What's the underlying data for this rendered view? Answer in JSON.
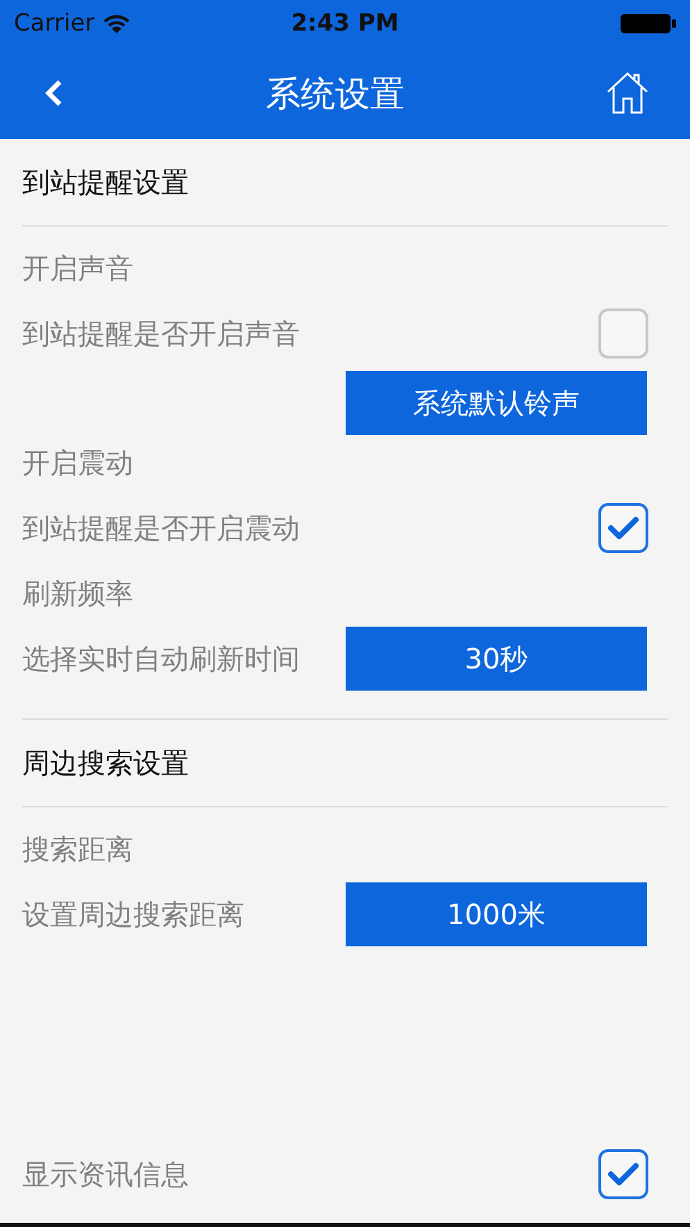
{
  "status_bar": {
    "carrier": "Carrier",
    "time": "2:43 PM"
  },
  "nav_bar": {
    "title": "系统设置"
  },
  "sections": [
    {
      "title": "到站提醒设置",
      "rows": [
        {
          "kind": "heading",
          "text": "开启声音"
        },
        {
          "kind": "checkbox",
          "label": "到站提醒是否开启声音",
          "checked": false
        },
        {
          "kind": "button",
          "text": "系统默认铃声"
        },
        {
          "kind": "heading",
          "text": "开启震动"
        },
        {
          "kind": "checkbox",
          "label": "到站提醒是否开启震动",
          "checked": true
        },
        {
          "kind": "heading",
          "text": "刷新频率"
        },
        {
          "kind": "select",
          "label": "选择实时自动刷新时间",
          "value": "30秒"
        }
      ]
    },
    {
      "title": "周边搜索设置",
      "rows": [
        {
          "kind": "heading",
          "text": "搜索距离"
        },
        {
          "kind": "select",
          "label": "设置周边搜索距离",
          "value": "1000米"
        }
      ]
    }
  ],
  "footer": {
    "label": "显示资讯信息",
    "checked": true
  }
}
